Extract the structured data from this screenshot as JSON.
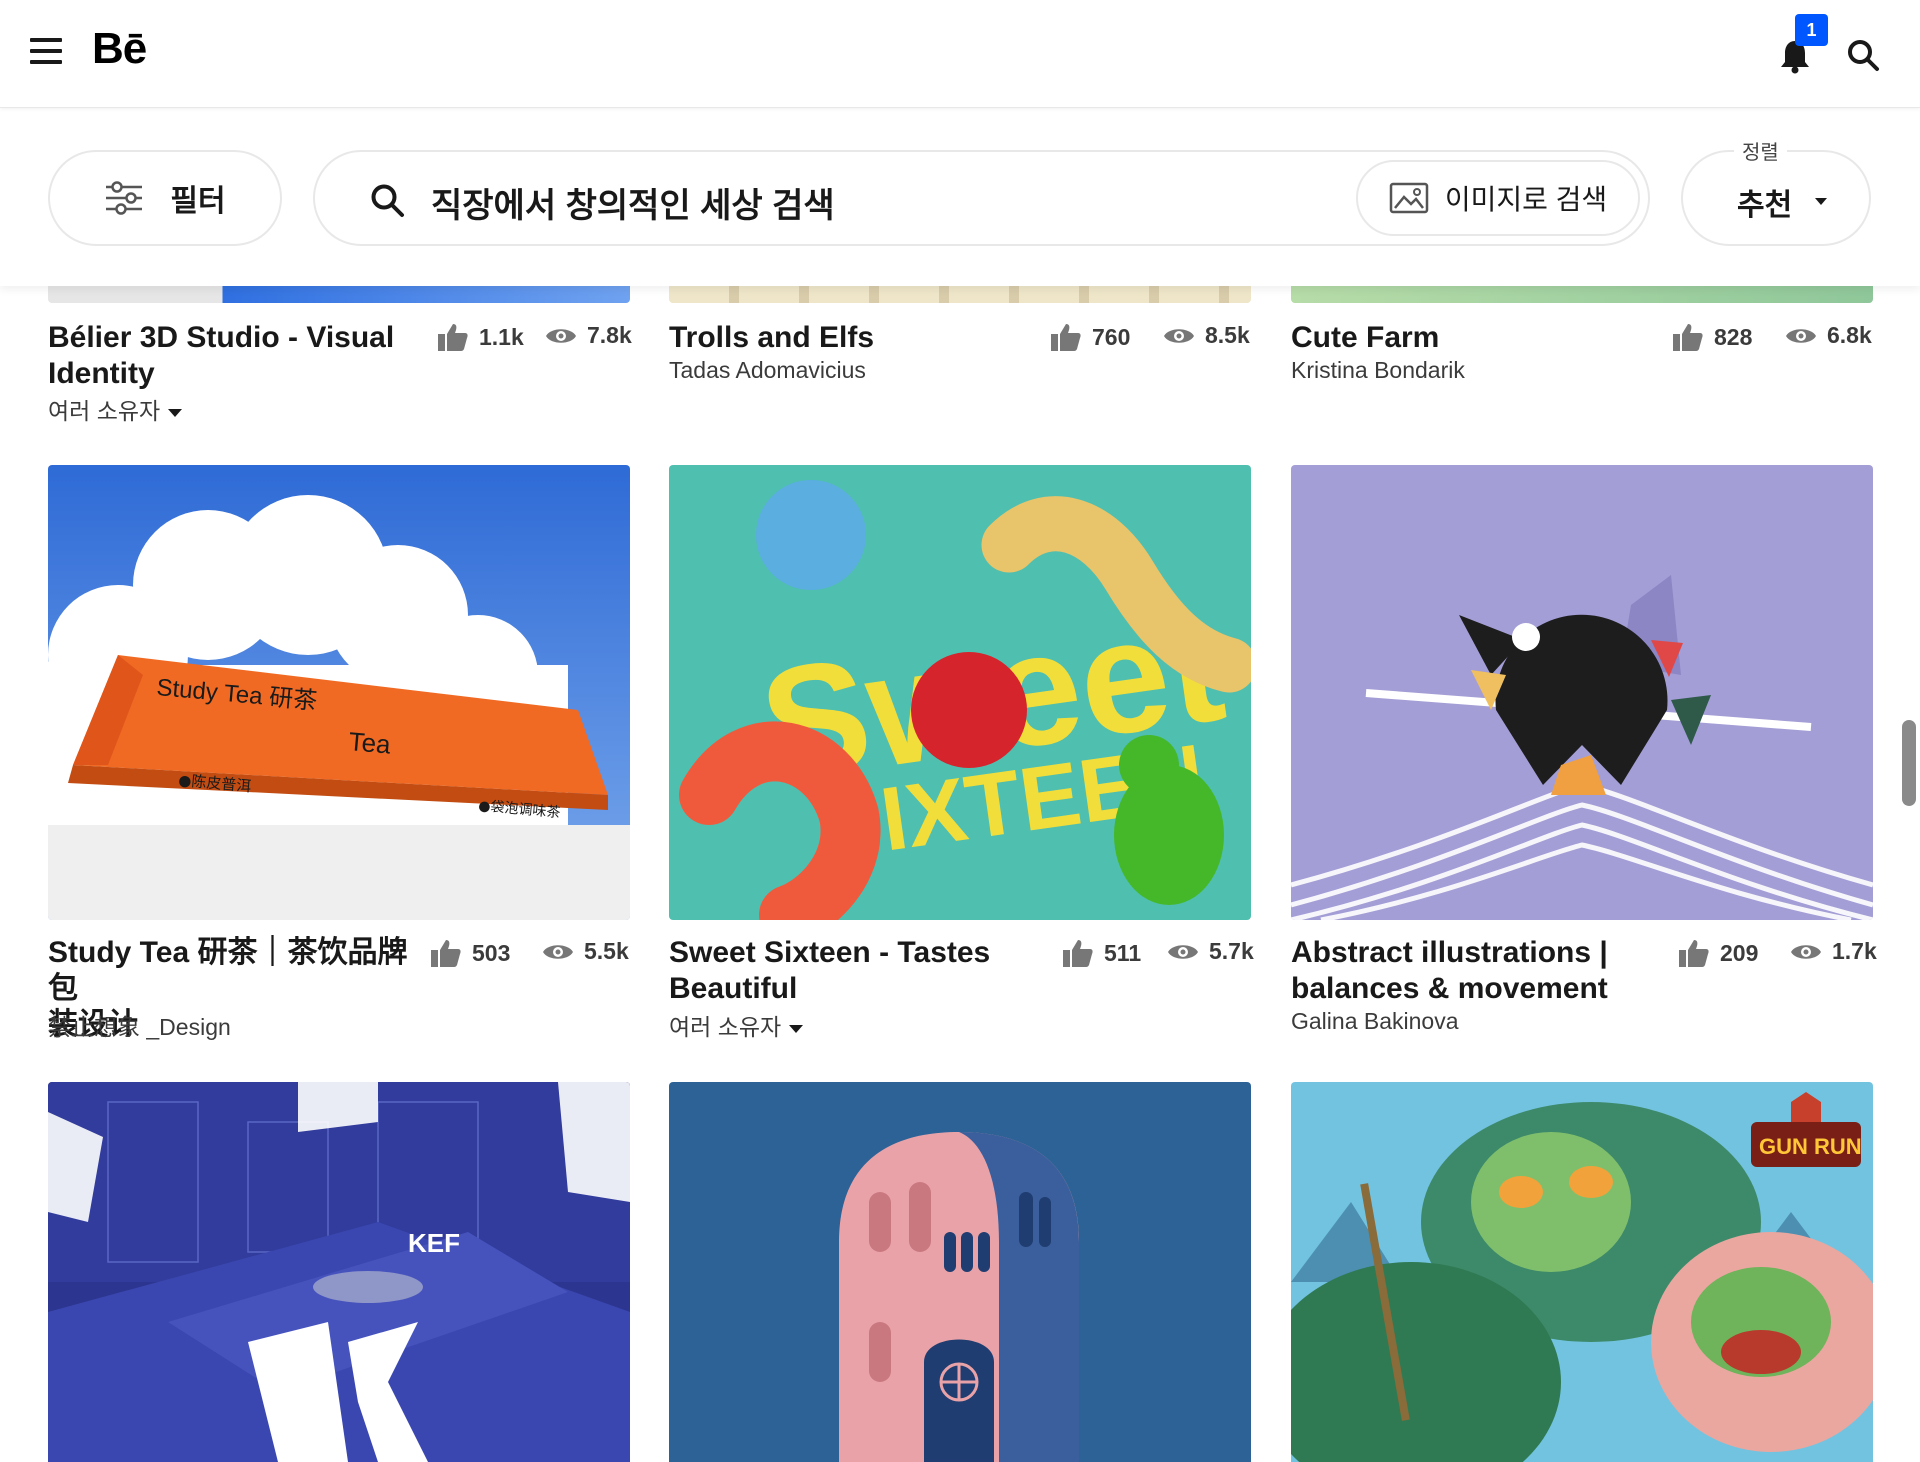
{
  "header": {
    "logo": "Bē",
    "notification_count": "1"
  },
  "filterbar": {
    "filter_label": "필터",
    "search_placeholder": "직장에서 창의적인 세상 검색",
    "image_search_label": "이미지로 검색",
    "sort_caption": "정렬",
    "sort_value": "추천"
  },
  "projects": [
    {
      "title_l1": "Bélier 3D Studio - Visual",
      "title_l2": "Identity",
      "owner": "여러 소유자",
      "owner_dropdown": true,
      "likes": "1.1k",
      "views": "7.8k"
    },
    {
      "title_l1": "Trolls and Elfs",
      "title_l2": "",
      "owner": "Tadas Adomavicius",
      "likes": "760",
      "views": "8.5k"
    },
    {
      "title_l1": "Cute Farm",
      "title_l2": "",
      "owner": "Kristina Bondarik",
      "likes": "828",
      "views": "6.8k"
    },
    {
      "title_l1": "Study Tea 研茶｜茶饮品牌包",
      "title_l2": "装设计",
      "owner": "禁止想象 _Design",
      "likes": "503",
      "views": "5.5k"
    },
    {
      "title_l1": "Sweet Sixteen - Tastes",
      "title_l2": "Beautiful",
      "owner": "여러 소유자",
      "owner_dropdown": true,
      "likes": "511",
      "views": "5.7k"
    },
    {
      "title_l1": "Abstract illustrations |",
      "title_l2": "balances & movement",
      "owner": "Galina Bakinova",
      "likes": "209",
      "views": "1.7k"
    }
  ],
  "images": {
    "study_tea": {
      "box_brand": "Study Tea 研茶",
      "box_word": "Tea",
      "left_label": "●陈皮普洱",
      "right_label": "●袋泡调味茶"
    },
    "sweet_sixteen": {
      "word1": "Sweet",
      "word2": "SIXTEEN"
    },
    "kef": {
      "brand": "KEF"
    },
    "gun_run": {
      "logo": "GUN RUN"
    }
  },
  "colors": {
    "accent": "#0057ff",
    "text": "#191919",
    "border": "#e8e8e8"
  }
}
